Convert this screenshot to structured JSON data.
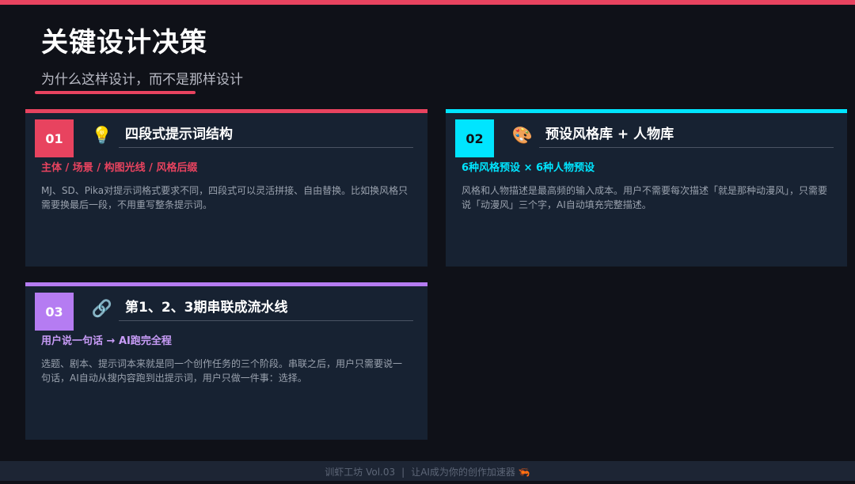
{
  "slide": {
    "title": "关键设计决策",
    "subtitle": "为什么这样设计，而不是那样设计"
  },
  "colors": {
    "red": "#e8435f",
    "cyan": "#00e5ff",
    "purple": "#b57cf2",
    "card_bg": "#172232",
    "page_bg": "#0f1118"
  },
  "cards": [
    {
      "number": "01",
      "icon": "💡",
      "icon_name": "lightbulb-icon",
      "title": "四段式提示词结构",
      "tag": "主体 / 场景 / 构图光线 / 风格后缀",
      "description": "MJ、SD、Pika对提示词格式要求不同，四段式可以灵活拼接、自由替换。比如换风格只需要换最后一段，不用重写整条提示词。"
    },
    {
      "number": "02",
      "icon": "🎨",
      "icon_name": "palette-icon",
      "title": "预设风格库 + 人物库",
      "tag": "6种风格预设 × 6种人物预设",
      "description": "风格和人物描述是最高频的输入成本。用户不需要每次描述「就是那种动漫风」，只需要说「动漫风」三个字，AI自动填充完整描述。"
    },
    {
      "number": "03",
      "icon": "🔗",
      "icon_name": "link-icon",
      "title": "第1、2、3期串联成流水线",
      "tag": "用户说一句话 → AI跑完全程",
      "description": "选题、剧本、提示词本来就是同一个创作任务的三个阶段。串联之后，用户只需要说一句话，AI自动从搜内容跑到出提示词，用户只做一件事：选择。"
    }
  ],
  "footer": {
    "brand": "训虾工坊 Vol.03",
    "divider": "|",
    "slogan": "让AI成为你的创作加速器",
    "icon": "🦐"
  }
}
